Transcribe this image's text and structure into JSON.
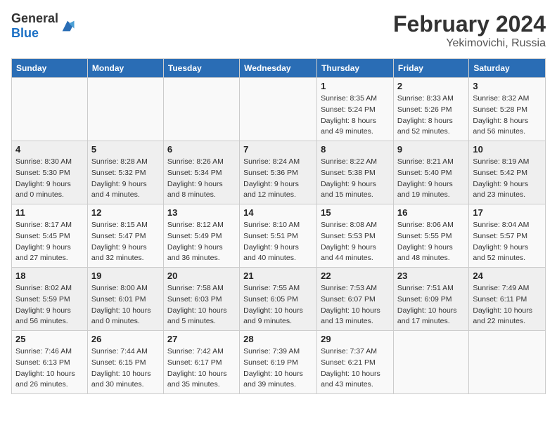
{
  "header": {
    "logo_general": "General",
    "logo_blue": "Blue",
    "main_title": "February 2024",
    "sub_title": "Yekimovichi, Russia"
  },
  "weekdays": [
    "Sunday",
    "Monday",
    "Tuesday",
    "Wednesday",
    "Thursday",
    "Friday",
    "Saturday"
  ],
  "weeks": [
    [
      {
        "day": "",
        "info": ""
      },
      {
        "day": "",
        "info": ""
      },
      {
        "day": "",
        "info": ""
      },
      {
        "day": "",
        "info": ""
      },
      {
        "day": "1",
        "info": "Sunrise: 8:35 AM\nSunset: 5:24 PM\nDaylight: 8 hours\nand 49 minutes."
      },
      {
        "day": "2",
        "info": "Sunrise: 8:33 AM\nSunset: 5:26 PM\nDaylight: 8 hours\nand 52 minutes."
      },
      {
        "day": "3",
        "info": "Sunrise: 8:32 AM\nSunset: 5:28 PM\nDaylight: 8 hours\nand 56 minutes."
      }
    ],
    [
      {
        "day": "4",
        "info": "Sunrise: 8:30 AM\nSunset: 5:30 PM\nDaylight: 9 hours\nand 0 minutes."
      },
      {
        "day": "5",
        "info": "Sunrise: 8:28 AM\nSunset: 5:32 PM\nDaylight: 9 hours\nand 4 minutes."
      },
      {
        "day": "6",
        "info": "Sunrise: 8:26 AM\nSunset: 5:34 PM\nDaylight: 9 hours\nand 8 minutes."
      },
      {
        "day": "7",
        "info": "Sunrise: 8:24 AM\nSunset: 5:36 PM\nDaylight: 9 hours\nand 12 minutes."
      },
      {
        "day": "8",
        "info": "Sunrise: 8:22 AM\nSunset: 5:38 PM\nDaylight: 9 hours\nand 15 minutes."
      },
      {
        "day": "9",
        "info": "Sunrise: 8:21 AM\nSunset: 5:40 PM\nDaylight: 9 hours\nand 19 minutes."
      },
      {
        "day": "10",
        "info": "Sunrise: 8:19 AM\nSunset: 5:42 PM\nDaylight: 9 hours\nand 23 minutes."
      }
    ],
    [
      {
        "day": "11",
        "info": "Sunrise: 8:17 AM\nSunset: 5:45 PM\nDaylight: 9 hours\nand 27 minutes."
      },
      {
        "day": "12",
        "info": "Sunrise: 8:15 AM\nSunset: 5:47 PM\nDaylight: 9 hours\nand 32 minutes."
      },
      {
        "day": "13",
        "info": "Sunrise: 8:12 AM\nSunset: 5:49 PM\nDaylight: 9 hours\nand 36 minutes."
      },
      {
        "day": "14",
        "info": "Sunrise: 8:10 AM\nSunset: 5:51 PM\nDaylight: 9 hours\nand 40 minutes."
      },
      {
        "day": "15",
        "info": "Sunrise: 8:08 AM\nSunset: 5:53 PM\nDaylight: 9 hours\nand 44 minutes."
      },
      {
        "day": "16",
        "info": "Sunrise: 8:06 AM\nSunset: 5:55 PM\nDaylight: 9 hours\nand 48 minutes."
      },
      {
        "day": "17",
        "info": "Sunrise: 8:04 AM\nSunset: 5:57 PM\nDaylight: 9 hours\nand 52 minutes."
      }
    ],
    [
      {
        "day": "18",
        "info": "Sunrise: 8:02 AM\nSunset: 5:59 PM\nDaylight: 9 hours\nand 56 minutes."
      },
      {
        "day": "19",
        "info": "Sunrise: 8:00 AM\nSunset: 6:01 PM\nDaylight: 10 hours\nand 0 minutes."
      },
      {
        "day": "20",
        "info": "Sunrise: 7:58 AM\nSunset: 6:03 PM\nDaylight: 10 hours\nand 5 minutes."
      },
      {
        "day": "21",
        "info": "Sunrise: 7:55 AM\nSunset: 6:05 PM\nDaylight: 10 hours\nand 9 minutes."
      },
      {
        "day": "22",
        "info": "Sunrise: 7:53 AM\nSunset: 6:07 PM\nDaylight: 10 hours\nand 13 minutes."
      },
      {
        "day": "23",
        "info": "Sunrise: 7:51 AM\nSunset: 6:09 PM\nDaylight: 10 hours\nand 17 minutes."
      },
      {
        "day": "24",
        "info": "Sunrise: 7:49 AM\nSunset: 6:11 PM\nDaylight: 10 hours\nand 22 minutes."
      }
    ],
    [
      {
        "day": "25",
        "info": "Sunrise: 7:46 AM\nSunset: 6:13 PM\nDaylight: 10 hours\nand 26 minutes."
      },
      {
        "day": "26",
        "info": "Sunrise: 7:44 AM\nSunset: 6:15 PM\nDaylight: 10 hours\nand 30 minutes."
      },
      {
        "day": "27",
        "info": "Sunrise: 7:42 AM\nSunset: 6:17 PM\nDaylight: 10 hours\nand 35 minutes."
      },
      {
        "day": "28",
        "info": "Sunrise: 7:39 AM\nSunset: 6:19 PM\nDaylight: 10 hours\nand 39 minutes."
      },
      {
        "day": "29",
        "info": "Sunrise: 7:37 AM\nSunset: 6:21 PM\nDaylight: 10 hours\nand 43 minutes."
      },
      {
        "day": "",
        "info": ""
      },
      {
        "day": "",
        "info": ""
      }
    ]
  ]
}
